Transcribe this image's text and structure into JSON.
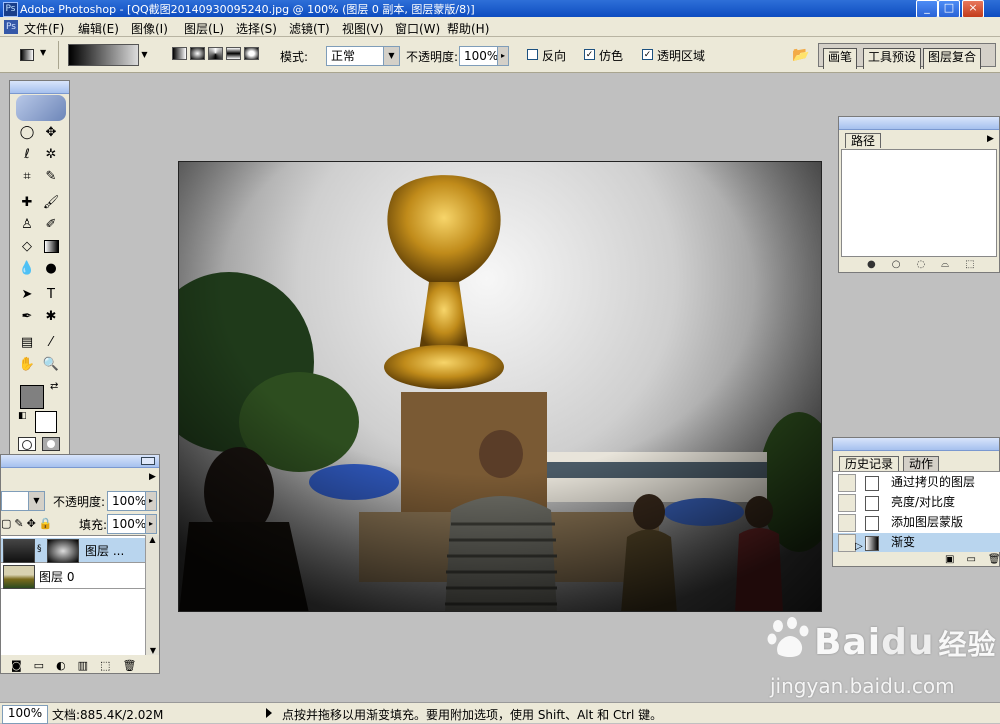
{
  "window": {
    "title": "Adobe Photoshop - [QQ截图20140930095240.jpg @ 100% (图层 0 副本, 图层蒙版/8)]",
    "buttons": [
      "_",
      "□",
      "×"
    ]
  },
  "menu": {
    "items": [
      "文件(F)",
      "编辑(E)",
      "图像(I)",
      "图层(L)",
      "选择(S)",
      "滤镜(T)",
      "视图(V)",
      "窗口(W)",
      "帮助(H)"
    ]
  },
  "options": {
    "mode_label": "模式:",
    "mode_value": "正常",
    "opacity_label": "不透明度:",
    "opacity_value": "100%",
    "reverse_label": "反向",
    "reverse_checked": false,
    "dither_label": "仿色",
    "dither_checked": true,
    "transparency_label": "透明区域",
    "transparency_checked": true,
    "palette_tabs": [
      "画笔",
      "工具预设",
      "图层复合"
    ]
  },
  "layers_panel": {
    "opacity_label": "不透明度:",
    "opacity_value": "100%",
    "fill_label": "填充:",
    "fill_value": "100%",
    "layers": [
      {
        "name": "图层 ..."
      },
      {
        "name": "图层 0"
      }
    ]
  },
  "paths_panel": {
    "tab": "路径"
  },
  "history_panel": {
    "tabs": [
      "历史记录",
      "动作"
    ],
    "items": [
      "通过拷贝的图层",
      "亮度/对比度",
      "添加图层蒙版",
      "渐变"
    ]
  },
  "status": {
    "zoom": "100%",
    "doc": "文档:885.4K/2.02M",
    "hint": "点按并拖移以用渐变填充。要用附加选项，使用 Shift、Alt 和 Ctrl 键。"
  },
  "watermark": {
    "brand": "Bai",
    "brand_du": "du",
    "brand_cn": "经验",
    "url": "jingyan.baidu.com"
  }
}
